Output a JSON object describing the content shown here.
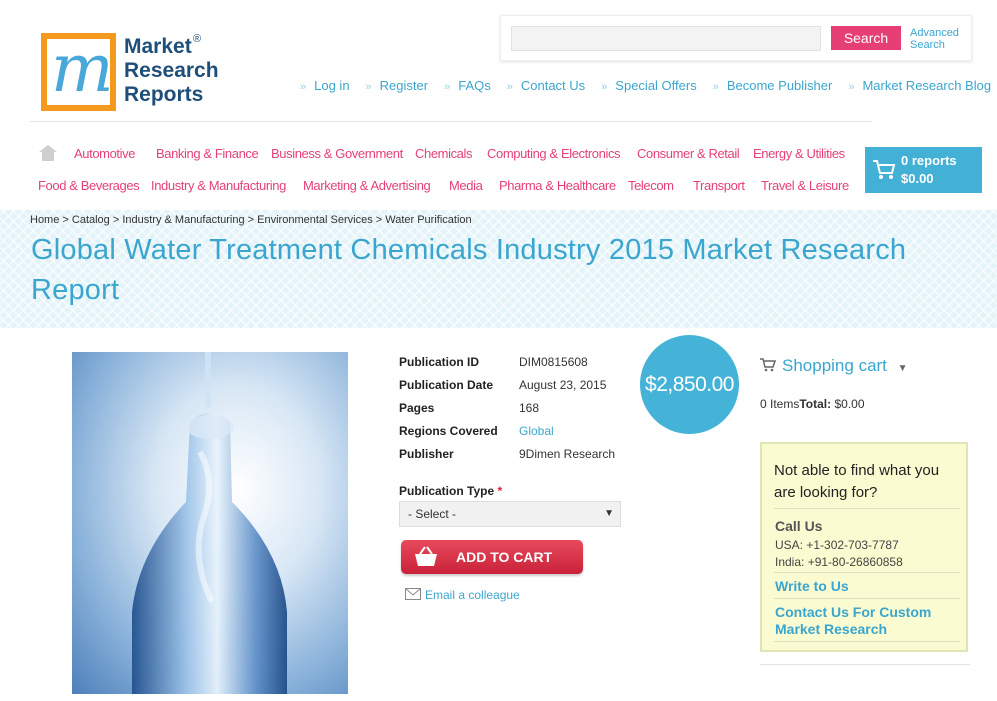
{
  "logo": {
    "line1": "Market",
    "line2": "Research",
    "line3": "Reports",
    "reg": "®"
  },
  "search": {
    "button": "Search",
    "advanced_line1": "Advanced",
    "advanced_line2": "Search"
  },
  "topnav": [
    "Log in",
    "Register",
    "FAQs",
    "Contact Us",
    "Special Offers",
    "Become Publisher",
    "Market Research Blog"
  ],
  "categories_row1": [
    "Automotive",
    "Banking & Finance",
    "Business & Government",
    "Chemicals",
    "Computing & Electronics",
    "Consumer & Retail",
    "Energy & Utilities"
  ],
  "categories_row2": [
    "Food & Beverages",
    "Industry & Manufacturing",
    "Marketing & Advertising",
    "Media",
    "Pharma & Healthcare",
    "Telecom",
    "Transport",
    "Travel & Leisure"
  ],
  "cart_button": {
    "reports": "0 reports",
    "amount": "$0.00"
  },
  "breadcrumb": "Home > Catalog > Industry & Manufacturing > Environmental Services > Water Purification",
  "title": "Global Water Treatment Chemicals Industry 2015 Market Research Report",
  "details": {
    "id_label": "Publication ID",
    "id_value": "DIM0815608",
    "date_label": "Publication Date",
    "date_value": "August 23, 2015",
    "pages_label": "Pages",
    "pages_value": "168",
    "regions_label": "Regions Covered",
    "regions_value": "Global",
    "publisher_label": "Publisher",
    "publisher_value": "9Dimen Research"
  },
  "price": "$2,850.00",
  "publication_type": {
    "label": "Publication Type",
    "required": "*",
    "selected": "- Select -"
  },
  "add_to_cart": "ADD TO CART",
  "email_colleague": "Email a colleague",
  "shopping_cart": {
    "title": "Shopping cart",
    "items": "0 Items",
    "total_label": "Total:",
    "total_value": "$0.00"
  },
  "help": {
    "question": "Not able to find what you are looking for?",
    "call_us": "Call Us",
    "usa": "USA: +1-302-703-7787",
    "india": "India: +91-80-26860858",
    "write": "Write to Us",
    "custom": "Contact Us For Custom Market Research"
  },
  "colors": {
    "accent_blue": "#3aa6cf",
    "pink": "#e6407b",
    "add_to_cart_red": "#d52f45"
  }
}
